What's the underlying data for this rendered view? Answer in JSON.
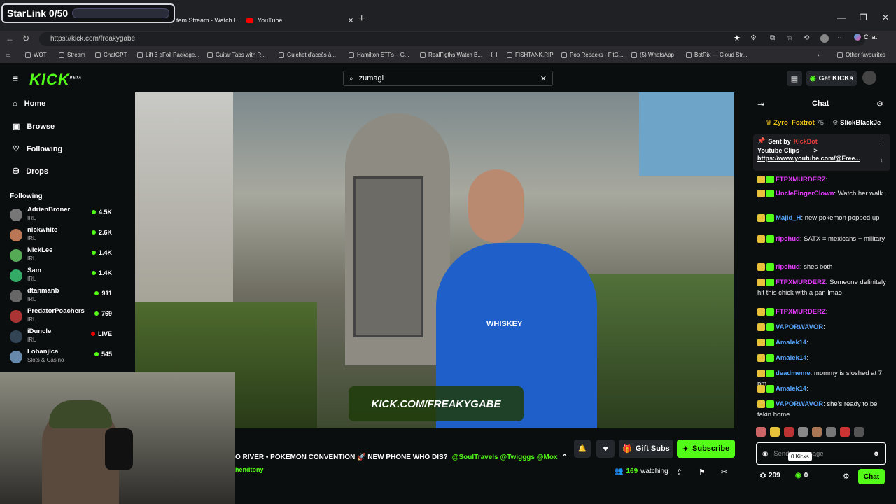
{
  "overlay": {
    "starlink_label": "StarLink 0/50",
    "progress": 0
  },
  "browser": {
    "tabs": [
      {
        "label": "tem Stream - Watch L"
      },
      {
        "label": "YouTube"
      }
    ],
    "url": "https://kick.com/freakygabe",
    "bookmarks": [
      "WOT",
      "Stream",
      "ChatGPT",
      "Lift 3 eFoil Package...",
      "Guitar Tabs with R...",
      "Guichet d'accès à...",
      "Hamilton ETFs – G...",
      "RealFigths Watch B...",
      "FISHTANK.RIP",
      "Pop Repacks - FitG...",
      "(5) WhatsApp",
      "BotRix — Cloud Str...",
      "Other favourites"
    ],
    "chat_btn": "Chat"
  },
  "kick": {
    "logo": "KICK",
    "logo_tag": "BETA",
    "search_value": "zumagi",
    "get_kicks": "Get KICKs",
    "nav": [
      {
        "label": "Home"
      },
      {
        "label": "Browse"
      },
      {
        "label": "Following"
      },
      {
        "label": "Drops"
      }
    ],
    "following_title": "Following",
    "following": [
      {
        "name": "AdrienBroner",
        "cat": "IRL",
        "viewers": "4.5K"
      },
      {
        "name": "nickwhite",
        "cat": "IRL",
        "viewers": "2.6K"
      },
      {
        "name": "NickLee",
        "cat": "IRL",
        "viewers": "1.4K"
      },
      {
        "name": "Sam",
        "cat": "IRL",
        "viewers": "1.4K"
      },
      {
        "name": "dtanmanb",
        "cat": "IRL",
        "viewers": "911"
      },
      {
        "name": "PredatorPoachers",
        "cat": "IRL",
        "viewers": "769"
      },
      {
        "name": "iDuncle",
        "cat": "IRL",
        "viewers": "LIVE"
      },
      {
        "name": "Lobanjica",
        "cat": "Slots & Casino",
        "viewers": "545"
      }
    ],
    "video_watermark": "KICK.COM/FREAKYGABE",
    "shirt_text": "WHISKEY",
    "stream_title": "O RIVER • POKEMON CONVENTION 🚀 NEW PHONE WHO DIS?",
    "stream_tags": "@SoulTravels @Twigggs @Mox",
    "streamer_sub": "hendtony",
    "gift_subs": "Gift Subs",
    "subscribe": "Subscribe",
    "watching_count": "169",
    "watching_label": "watching"
  },
  "chat": {
    "title": "Chat",
    "top_gifters": [
      {
        "name": "Zyro_Foxtrot",
        "amount": "75"
      },
      {
        "name": "SlickBlackJe",
        "amount": ""
      }
    ],
    "pinned": {
      "sent_by": "Sent by",
      "bot": "KickBot",
      "line1": "Youtube Clips ——>",
      "line2": "https://www.youtube.com/@Free..."
    },
    "messages": [
      {
        "user": "FTPXMURDERZ",
        "color": "#e73cff",
        "text": ""
      },
      {
        "user": "UncleFingerClown",
        "color": "#e73cff",
        "text": "Watch her walk..."
      },
      {
        "user": "Majid_H",
        "color": "#58a6ff",
        "text": "new pokemon popped up"
      },
      {
        "user": "ripchud",
        "color": "#e73cff",
        "text": "SATX = mexicans + military"
      },
      {
        "user": "ripchud",
        "color": "#e73cff",
        "text": "shes both"
      },
      {
        "user": "FTPXMURDERZ",
        "color": "#e73cff",
        "text": "Someone definitely hit this chick with a pan lmao"
      },
      {
        "user": "FTPXMURDERZ",
        "color": "#e73cff",
        "text": ""
      },
      {
        "user": "VAPORWAVOR",
        "color": "#58a6ff",
        "text": ""
      },
      {
        "user": "Amalek14",
        "color": "#58a6ff",
        "text": ""
      },
      {
        "user": "Amalek14",
        "color": "#58a6ff",
        "text": ""
      },
      {
        "user": "deadmeme",
        "color": "#58a6ff",
        "text": "mommy is sloshed at 7 pm"
      },
      {
        "user": "Amalek14",
        "color": "#58a6ff",
        "text": ""
      },
      {
        "user": "VAPORWAVOR",
        "color": "#58a6ff",
        "text": "she's ready to be takin home"
      }
    ],
    "input_placeholder": "Send a message",
    "kicks_tooltip": "0 Kicks",
    "points": "209",
    "kicks": "0",
    "chat_button": "Chat"
  }
}
